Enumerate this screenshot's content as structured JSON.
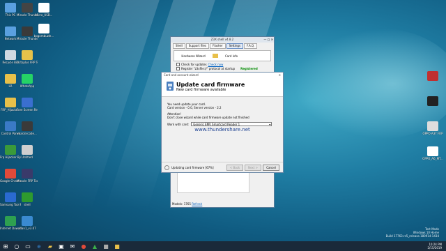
{
  "desktop": {
    "left_icons": [
      {
        "label": "This PC",
        "color": "#5aa0e0"
      },
      {
        "label": "Network",
        "color": "#5aa0e0"
      },
      {
        "label": "Recycle Bin",
        "color": "#cfd8e2"
      },
      {
        "label": "LR",
        "color": "#e8c04a"
      },
      {
        "label": "FRP_Hijacke...",
        "color": "#e8c04a"
      },
      {
        "label": "Control Panel",
        "color": "#3a7ac6"
      },
      {
        "label": "Frp Hijacker By Hagard",
        "color": "#3a9a3a"
      },
      {
        "label": "Google Chrome",
        "color": "#e04a3a"
      },
      {
        "label": "Samsung Tool PRO",
        "color": "#2a6ad0"
      },
      {
        "label": "Internet Downlo...",
        "color": "#2ea050"
      }
    ],
    "col2_icons": [
      {
        "label": "Miracle Thunder Support",
        "color": "#444"
      },
      {
        "label": "Miracle Thunder",
        "color": "#3a3a3a"
      },
      {
        "label": "Octoplus FRP Tool",
        "color": "#e6c24a"
      },
      {
        "label": "WhatsApp",
        "color": "#25d366"
      },
      {
        "label": "Free Screen Recorder",
        "color": "#3a6fd0"
      },
      {
        "label": "mastercode...",
        "color": "#3a3a3a"
      },
      {
        "label": "Untitled",
        "color": "#cfcfcf"
      },
      {
        "label": "Miracle FRP Tool",
        "color": "#3a3a6a"
      },
      {
        "label": "shell",
        "color": "#2e9a2e"
      },
      {
        "label": "zdan1_v3.07",
        "color": "#3a8ad0"
      }
    ],
    "col3_icons": [
      {
        "label": "Micro_USB...",
        "color": "#fff"
      },
      {
        "label": "bogombuzle...",
        "color": "#fff"
      }
    ],
    "right_icons": [
      {
        "label": "",
        "color": "#c03030"
      },
      {
        "label": "",
        "color": "#222"
      },
      {
        "label": "OPPO A37 FRP",
        "color": "#ddd"
      },
      {
        "label": "OPPO_A6_MT...",
        "color": "#fff"
      }
    ]
  },
  "app_window": {
    "title": "Z3X shell v4.8.2",
    "tabs": [
      "Shell",
      "Support files",
      "Flasher",
      "Settings",
      "F.A.Q."
    ],
    "active_tab": "Settings",
    "hardware_wizard_label": "Hardware Wizard",
    "card_info_label": "Card info",
    "check_updates_label": "Check for updates",
    "check_now_label": "Check now",
    "register_label": "Register \"z3xfile://\" protocol at startup",
    "registered_label": "Registered",
    "status_text": "Models: 1765",
    "refresh_label": "Refresh"
  },
  "wizard": {
    "window_title": "Card and account wizard",
    "title": "Update card firmware",
    "subtitle": "New card firmware available",
    "line1": "You need update your card.",
    "line2": "Card version - 0.0, Server version - 2.2",
    "line3": "Attention!",
    "line4": "Don't close wizard while card firmware update not finished",
    "work_with_label": "Work with card:",
    "card_value": "Generic EMV Smartcard Reader 1",
    "brand_text": "www.thundershare.net",
    "status": "Updating card firmware [67%]",
    "back_label": "< Back",
    "next_label": "Next >",
    "cancel_label": "Cancel",
    "progress": 0.67
  },
  "taskbar": {
    "time": "10:24 PM",
    "date": "2/15/2019",
    "lang": "ENG",
    "watermark_line1": "Test Mode",
    "watermark_line2": "Windows 10 Home",
    "watermark_line3": "Build 17763.rs5_release.180914-1434"
  }
}
